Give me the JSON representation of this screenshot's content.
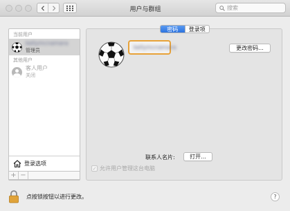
{
  "window": {
    "title": "用户与群组",
    "search_placeholder": "搜索"
  },
  "sidebar": {
    "current_users_label": "当前用户",
    "current_user": {
      "name": "kellymcnamara",
      "role": "管理员"
    },
    "other_users_label": "其他用户",
    "guest_user": {
      "name": "客人用户",
      "status": "关闭"
    },
    "login_options": "登录选项",
    "add": "+",
    "remove": "−"
  },
  "detail": {
    "tabs": [
      "密码",
      "登录项"
    ],
    "active_tab": 0,
    "full_name": "kellymcnamara",
    "change_password": "更改密码...",
    "contact_card_label": "联系人名片:",
    "open_button": "打开...",
    "allow_admin": "允许用户管理这台电脑"
  },
  "footer": {
    "lock_text": "点按锁按钮以进行更改。",
    "help": "?"
  },
  "colors": {
    "accent": "#2c73e0",
    "focus_ring": "#e8a238"
  }
}
